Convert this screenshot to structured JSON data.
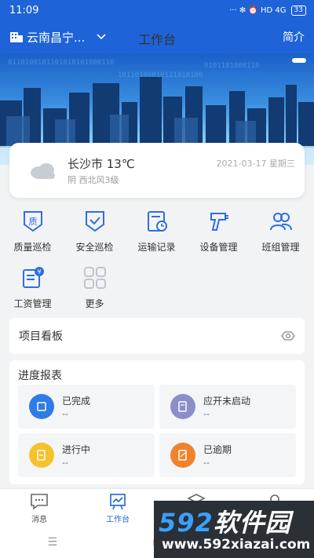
{
  "status": {
    "time": "11:09",
    "indicators": "··· ✻ ⏰ HD 4G",
    "battery": "33"
  },
  "header": {
    "location": "云南昌宁...",
    "title": "工作台",
    "intro": "简介"
  },
  "weather": {
    "city_temp": "长沙市 13℃",
    "condition": "阴 西北风3级",
    "date": "2021-03-17 星期三"
  },
  "menu": {
    "items": [
      {
        "label": "质量巡检",
        "icon": "quality-inspection-icon"
      },
      {
        "label": "安全巡检",
        "icon": "safety-inspection-icon"
      },
      {
        "label": "运输记录",
        "icon": "transport-record-icon"
      },
      {
        "label": "设备管理",
        "icon": "equipment-icon"
      },
      {
        "label": "班组管理",
        "icon": "team-icon"
      },
      {
        "label": "工资管理",
        "icon": "salary-icon"
      },
      {
        "label": "更多",
        "icon": "more-grid-icon"
      }
    ]
  },
  "board": {
    "title": "项目看板"
  },
  "progress": {
    "title": "进度报表",
    "cards": [
      {
        "label": "已完成",
        "value": "--",
        "color": "#2f7be8"
      },
      {
        "label": "应开未启动",
        "value": "--",
        "color": "#8a8fc7"
      },
      {
        "label": "进行中",
        "value": "--",
        "color": "#f5c22b"
      },
      {
        "label": "已逾期",
        "value": "--",
        "color": "#f0822c"
      }
    ]
  },
  "tabs": [
    {
      "label": "消息",
      "icon": "message-icon"
    },
    {
      "label": "工作台",
      "icon": "workbench-icon"
    },
    {
      "label": "",
      "icon": "layers-icon"
    },
    {
      "label": "",
      "icon": "profile-icon"
    }
  ],
  "watermark": {
    "main_num": "592",
    "main_text": "软件园",
    "url": "www.592xiazai.com"
  },
  "colors": {
    "primary": "#1e63d8",
    "background": "#f2f3f5"
  }
}
